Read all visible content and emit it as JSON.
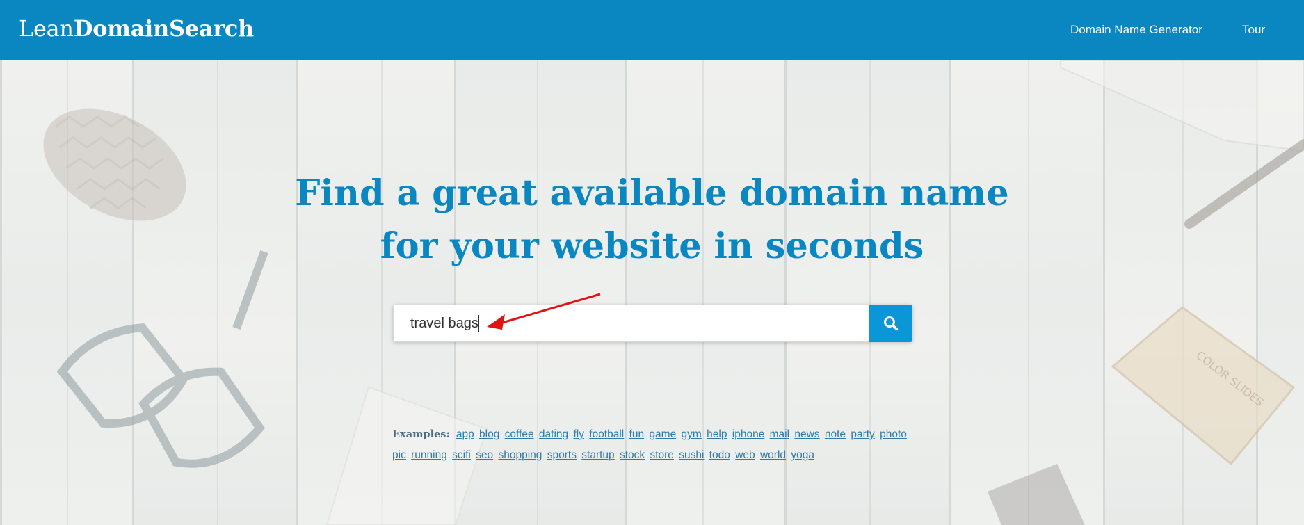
{
  "header": {
    "logo_light": "Lean",
    "logo_bold": "DomainSearch",
    "nav": [
      {
        "label": "Domain Name Generator"
      },
      {
        "label": "Tour"
      }
    ]
  },
  "hero": {
    "headline_line1": "Find a great available domain name",
    "headline_line2": "for your website in seconds"
  },
  "search": {
    "value": "travel bags",
    "button_icon": "search-icon"
  },
  "examples": {
    "label": "Examples:",
    "items": [
      "app",
      "blog",
      "coffee",
      "dating",
      "fly",
      "football",
      "fun",
      "game",
      "gym",
      "help",
      "iphone",
      "mail",
      "news",
      "note",
      "party",
      "photo",
      "pic",
      "running",
      "scifi",
      "seo",
      "shopping",
      "sports",
      "startup",
      "stock",
      "store",
      "sushi",
      "todo",
      "web",
      "world",
      "yoga"
    ]
  },
  "colors": {
    "header_bg": "#0a87c0",
    "accent": "#0a96d7",
    "headline": "#0a87c0",
    "annotation_arrow": "#e01414"
  }
}
